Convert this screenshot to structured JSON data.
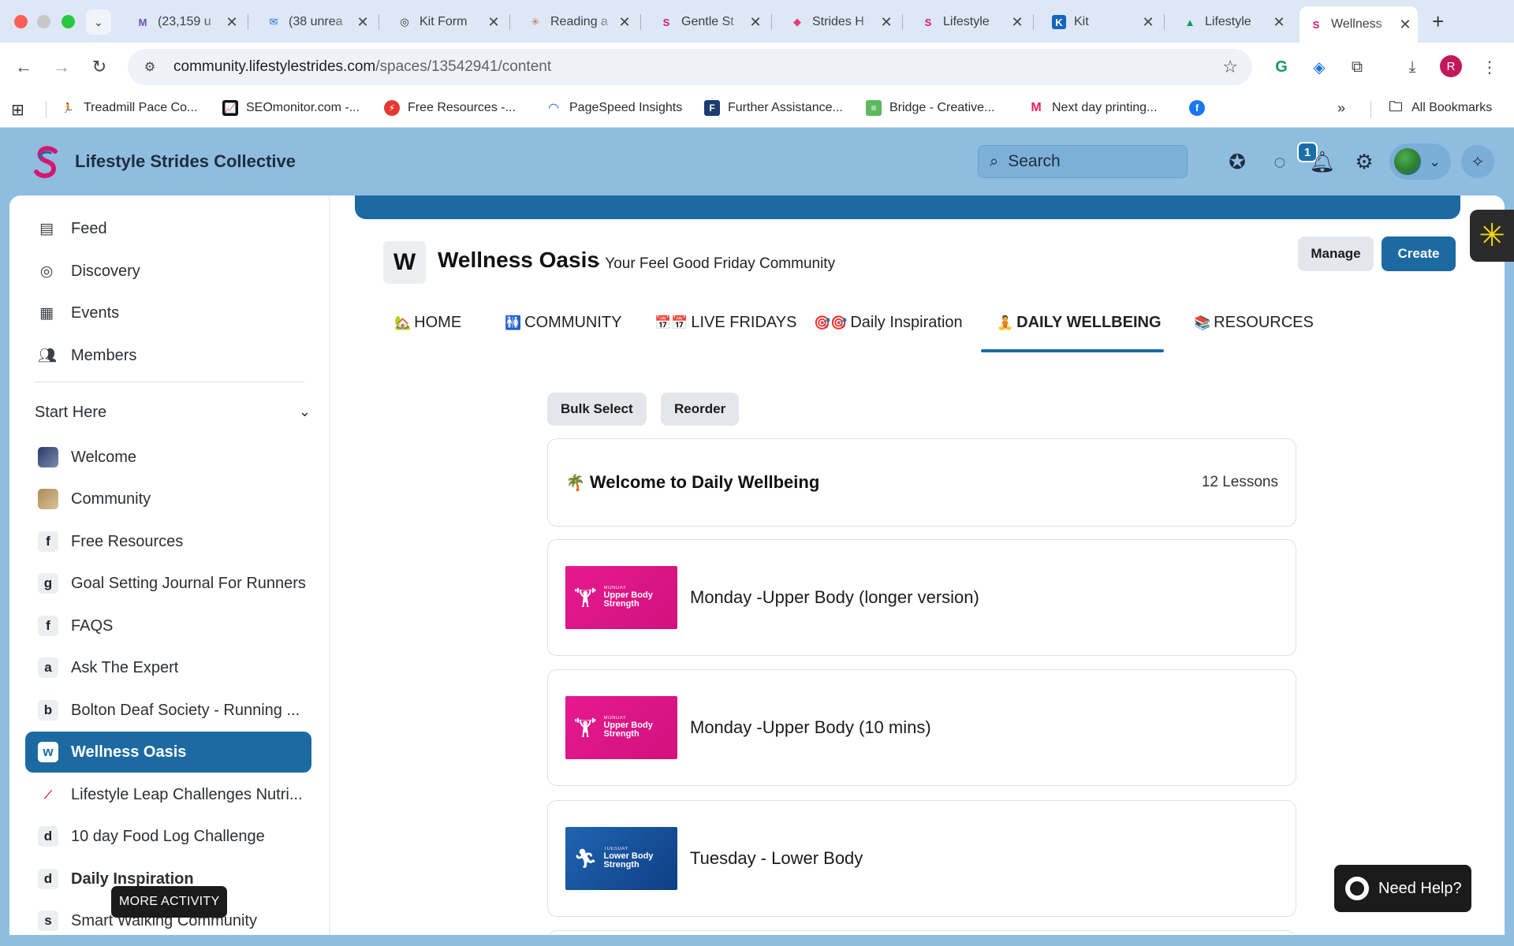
{
  "browser": {
    "tabs": [
      {
        "label": "(23,159 u",
        "favicon": "M",
        "favicon_color": "#6b4fbb"
      },
      {
        "label": "(38 unrea",
        "favicon": "✉",
        "favicon_color": "#1a73e8"
      },
      {
        "label": "Kit Form",
        "favicon": "◎",
        "favicon_color": "#333333"
      },
      {
        "label": "Reading a",
        "favicon": "✳",
        "favicon_color": "#d9653b"
      },
      {
        "label": "Gentle St",
        "favicon": "S",
        "favicon_color": "#d6186f"
      },
      {
        "label": "Strides H",
        "favicon": "◆",
        "favicon_color": "#e63b6f"
      },
      {
        "label": "Lifestyle",
        "favicon": "S",
        "favicon_color": "#d6186f"
      },
      {
        "label": "Kit",
        "favicon": "K",
        "favicon_color": "#1565c0"
      },
      {
        "label": "Lifestyle",
        "favicon": "▲",
        "favicon_color": "#0f9d58"
      },
      {
        "label": "Wellness",
        "favicon": "S",
        "favicon_color": "#d6186f"
      }
    ],
    "url_host": "community.lifestylestrides.com",
    "url_path": "/spaces/13542941/content",
    "profile_initial": "R",
    "bookmarks": [
      {
        "label": "Treadmill Pace Co...",
        "icon": "🏃"
      },
      {
        "label": "SEOmonitor.com -...",
        "icon": "📈"
      },
      {
        "label": "Free Resources -...",
        "icon": "⚡"
      },
      {
        "label": "PageSpeed Insights",
        "icon": "◠"
      },
      {
        "label": "Further Assistance...",
        "icon": "F"
      },
      {
        "label": "Bridge - Creative...",
        "icon": "≡"
      },
      {
        "label": "Next day printing...",
        "icon": "M"
      },
      {
        "label": "",
        "icon": "f"
      }
    ],
    "all_bookmarks_label": "All Bookmarks"
  },
  "header": {
    "brand": "Lifestyle Strides Collective",
    "search_placeholder": "Search",
    "notification_count": "1"
  },
  "sidebar": {
    "nav": [
      {
        "label": "Feed",
        "icon": "feed-icon"
      },
      {
        "label": "Discovery",
        "icon": "compass-icon"
      },
      {
        "label": "Events",
        "icon": "calendar-icon"
      },
      {
        "label": "Members",
        "icon": "members-icon"
      }
    ],
    "section_title": "Start Here",
    "spaces": [
      {
        "label": "Welcome",
        "initial": ""
      },
      {
        "label": "Community",
        "initial": ""
      },
      {
        "label": "Free Resources",
        "initial": "f"
      },
      {
        "label": "Goal Setting Journal For Runners",
        "initial": "g"
      },
      {
        "label": "FAQS",
        "initial": "f"
      },
      {
        "label": "Ask The Expert",
        "initial": "a"
      },
      {
        "label": "Bolton Deaf Society - Running ...",
        "initial": "b"
      },
      {
        "label": "Wellness Oasis",
        "initial": "w"
      },
      {
        "label": "Lifestyle Leap Challenges Nutri...",
        "initial": ""
      },
      {
        "label": "10 day Food Log Challenge",
        "initial": "d"
      },
      {
        "label": "Daily Inspiration",
        "initial": "d"
      },
      {
        "label": "Smart Walking Community",
        "initial": "s"
      }
    ],
    "tooltip": "MORE ACTIVITY"
  },
  "space": {
    "logo_initial": "W",
    "title": "Wellness Oasis",
    "subtitle": "· Your Feel Good Friday Community",
    "manage_label": "Manage",
    "create_label": "Create",
    "tabs": [
      {
        "emoji": "🏡",
        "label": "HOME"
      },
      {
        "emoji": "🚻",
        "label": "COMMUNITY"
      },
      {
        "emoji": "📅📅",
        "label": "LIVE FRIDAYS"
      },
      {
        "emoji": "🎯🎯",
        "label": "Daily Inspiration"
      },
      {
        "emoji": "🧘",
        "label": "DAILY WELLBEING"
      },
      {
        "emoji": "📚",
        "label": "RESOURCES"
      }
    ],
    "active_tab": "DAILY WELLBEING",
    "bulk_select_label": "Bulk Select",
    "reorder_label": "Reorder",
    "section": {
      "emoji": "🌴",
      "title": "Welcome to Daily Wellbeing",
      "lesson_count": "12 Lessons"
    },
    "lessons": [
      {
        "title": "Monday -Upper Body (longer version)",
        "thumb_day": "MONDAY",
        "thumb_title": "Upper Body Strength",
        "thumb_color": "pink"
      },
      {
        "title": "Monday -Upper Body (10 mins)",
        "thumb_day": "MONDAY",
        "thumb_title": "Upper Body Strength",
        "thumb_color": "pink"
      },
      {
        "title": "Tuesday - Lower Body",
        "thumb_day": "TUESDAY",
        "thumb_title": "Lower Body Strength",
        "thumb_color": "blue"
      }
    ]
  },
  "help_button": "Need Help?",
  "colors": {
    "accent": "#1d6aa3",
    "header_bg": "#8fbde0",
    "lesson_pink": "#e6198f",
    "lesson_blue": "#1f64b0"
  }
}
